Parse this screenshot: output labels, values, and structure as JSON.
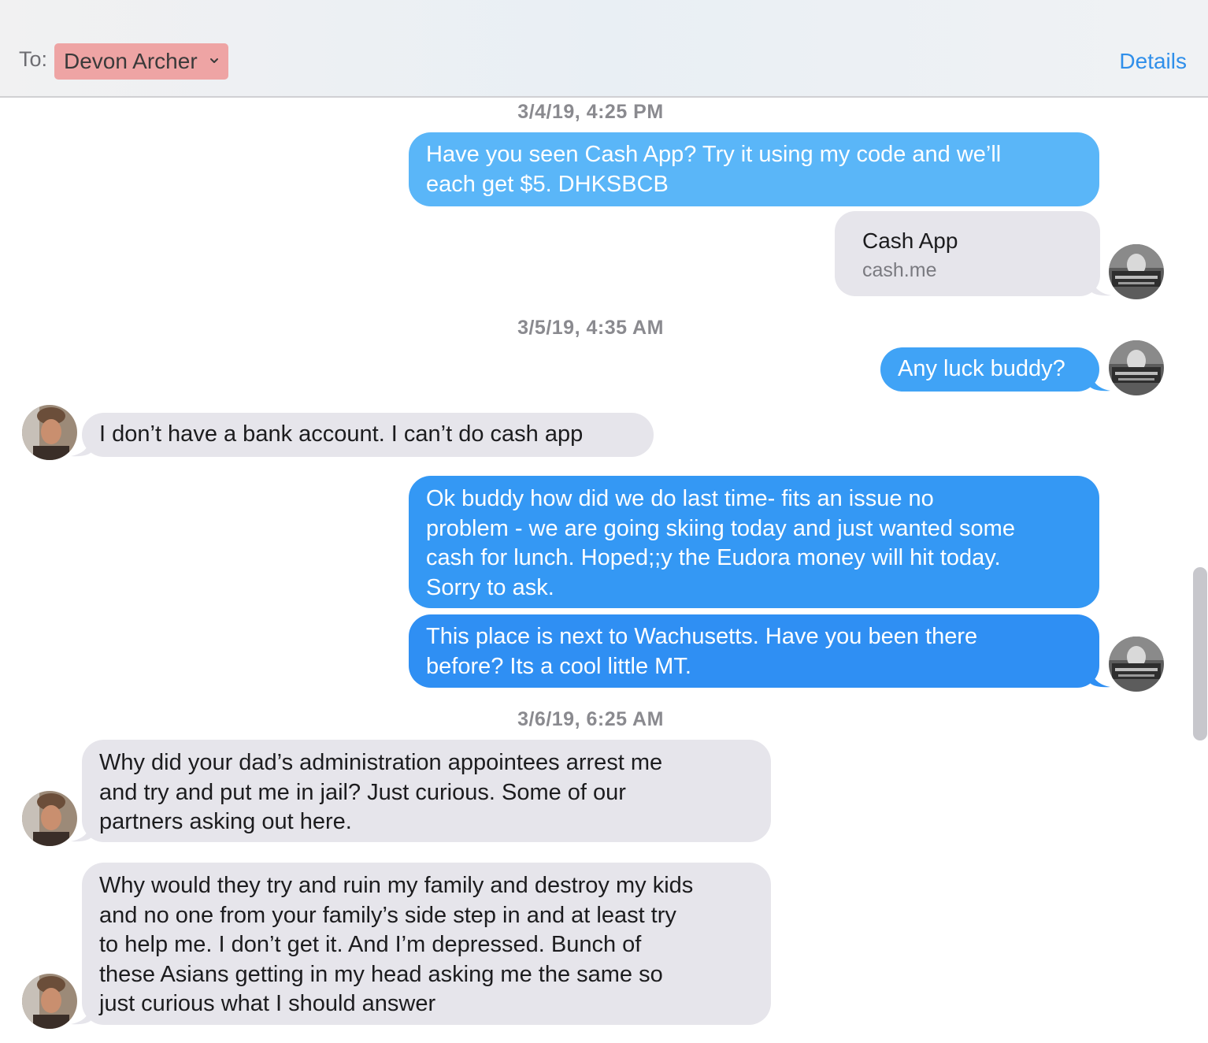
{
  "header": {
    "to_label": "To:",
    "recipient": "Devon Archer",
    "details_label": "Details"
  },
  "colors": {
    "outgoing_light": "#5ab6f8",
    "outgoing_dark": "#2f8ff3",
    "incoming": "#e6e5eb",
    "accent": "#2f8fea",
    "recipient_chip": "#eea4a4"
  },
  "thread": {
    "timestamps": [
      "3/4/19, 4:25 PM",
      "3/5/19, 4:35 AM",
      "3/6/19, 6:25 AM"
    ],
    "messages": [
      {
        "direction": "outgoing",
        "text": "Have you seen Cash App? Try it using my code and we’ll\neach get $5. DHKSBCB"
      },
      {
        "direction": "outgoing",
        "type": "link-preview",
        "title": "Cash App",
        "url": "cash.me"
      },
      {
        "direction": "outgoing",
        "text": "Any luck buddy?"
      },
      {
        "direction": "incoming",
        "text": "I don’t have a bank account.  I can’t do cash app"
      },
      {
        "direction": "outgoing",
        "text": "Ok buddy how did we do last time- fits an issue no\nproblem - we are going skiing today and just wanted some\ncash for lunch. Hoped;;y the Eudora money will hit today.\n Sorry to ask."
      },
      {
        "direction": "outgoing",
        "text": "This place is next to Wachusetts.  Have you been there\nbefore? Its a cool little MT."
      },
      {
        "direction": "incoming",
        "text": "Why did your dad’s administration appointees arrest me\nand try and put me in jail?  Just curious. Some of our\npartners asking out here."
      },
      {
        "direction": "incoming",
        "text": "Why would they try and ruin my family and destroy my kids\nand no one from your family’s side step in and at least try\nto help me.  I don’t get it.  And I’m depressed.  Bunch of\nthese Asians getting in my head asking me the same so\njust curious what I should answer"
      }
    ]
  }
}
